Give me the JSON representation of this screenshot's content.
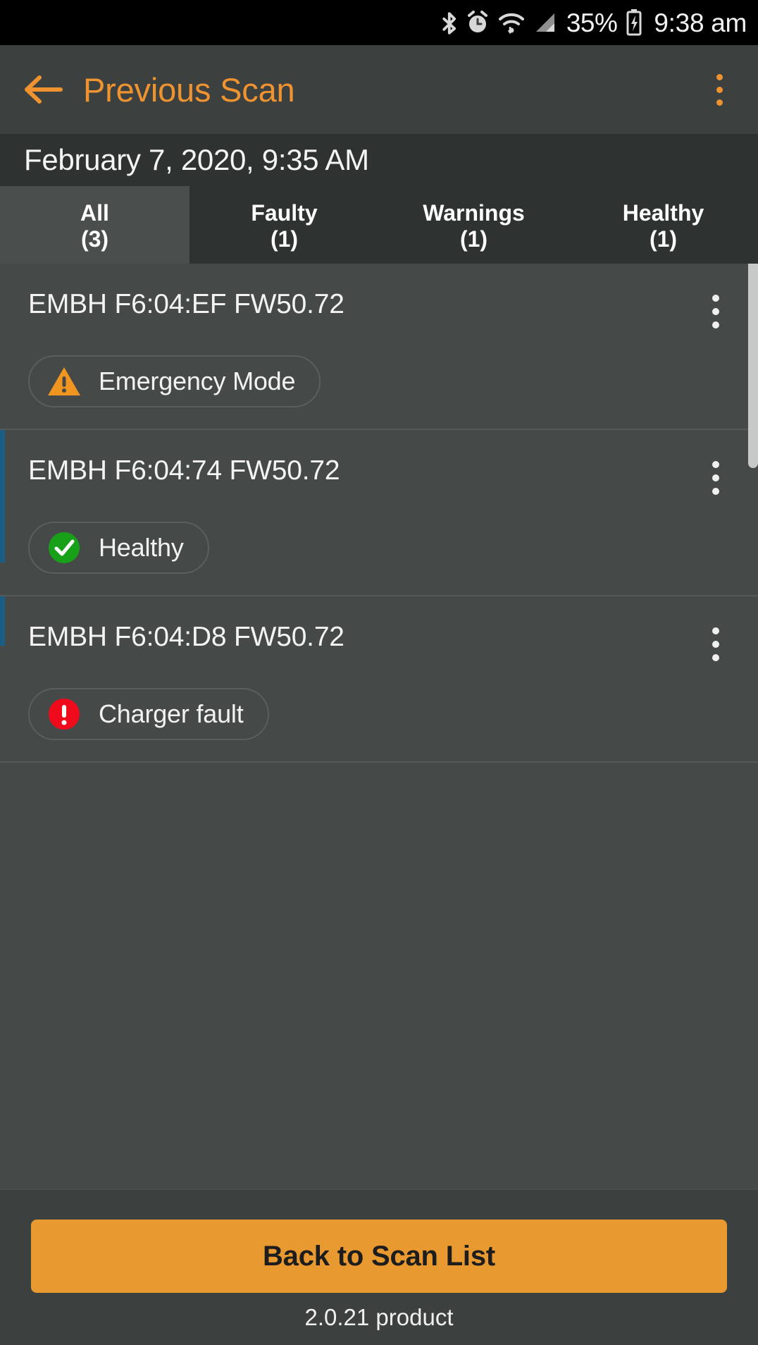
{
  "status_bar": {
    "icons": [
      "bluetooth-icon",
      "alarm-icon",
      "wifi-icon",
      "cellular-signal-icon"
    ],
    "battery_percent": "35%",
    "battery_state": "charging",
    "time": "9:38 am"
  },
  "app_bar": {
    "back_label": "back-arrow",
    "title": "Previous Scan",
    "overflow_label": "More options"
  },
  "scan_header": {
    "timestamp": "February 7, 2020, 9:35 AM"
  },
  "tabs": [
    {
      "label": "All",
      "count": "(3)",
      "selected": true
    },
    {
      "label": "Faulty",
      "count": "(1)",
      "selected": false
    },
    {
      "label": "Warnings",
      "count": "(1)",
      "selected": false
    },
    {
      "label": "Healthy",
      "count": "(1)",
      "selected": false
    }
  ],
  "devices": [
    {
      "name": "EMBH F6:04:EF FW50.72",
      "status_label": "Emergency Mode",
      "status_icon": "warning-triangle-icon",
      "status_color": "#f0951f"
    },
    {
      "name": "EMBH F6:04:74 FW50.72",
      "status_label": "Healthy",
      "status_icon": "check-circle-icon",
      "status_color": "#18a018"
    },
    {
      "name": "EMBH F6:04:D8 FW50.72",
      "status_label": "Charger fault",
      "status_icon": "error-circle-icon",
      "status_color": "#ef0b1c"
    }
  ],
  "bottom_bar": {
    "primary_button": "Back to Scan List",
    "version": "2.0.21 product"
  },
  "colors": {
    "accent": "#ef9330",
    "button": "#e8992f",
    "page_bg": "#3f4443",
    "list_bg": "#454a49",
    "header_bg": "#2e3230",
    "selected_tab_bg": "#4a4f4e",
    "stripe": "#1a5e86"
  }
}
